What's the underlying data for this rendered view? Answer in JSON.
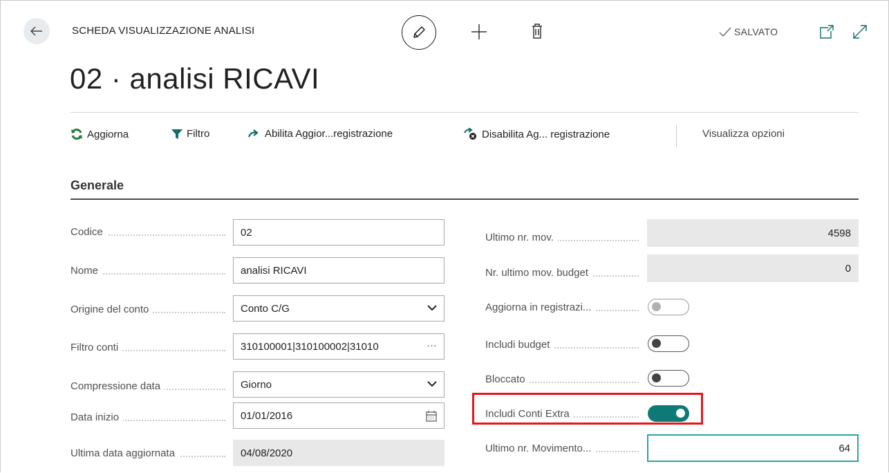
{
  "header": {
    "caption": "SCHEDA VISUALIZZAZIONE ANALISI",
    "title": "02 · analisi RICAVI",
    "saved_status": "SALVATO"
  },
  "actions": [
    {
      "label": "Aggiorna",
      "icon": "refresh-icon"
    },
    {
      "label": "Filtro",
      "icon": "filter-icon"
    },
    {
      "label": "Abilita Aggior...registrazione",
      "icon": "enable-update-icon"
    },
    {
      "label": "Disabilita Ag... registrazione",
      "icon": "disable-update-icon"
    },
    {
      "label": "Visualizza opzioni"
    }
  ],
  "section": {
    "title": "Generale"
  },
  "left_fields": {
    "code": {
      "label": "Codice",
      "value": "02"
    },
    "name": {
      "label": "Nome",
      "value": "analisi RICAVI"
    },
    "account_source": {
      "label": "Origine del conto",
      "value": "Conto C/G"
    },
    "account_filter": {
      "label": "Filtro conti",
      "value": "310100001|310100002|31010",
      "suffix": "···"
    },
    "date_compression": {
      "label": "Compressione data",
      "value": "Giorno"
    },
    "start_date": {
      "label": "Data inizio",
      "value": "01/01/2016"
    },
    "last_updated_date": {
      "label": "Ultima data aggiornata",
      "value": "04/08/2020"
    }
  },
  "right_fields": {
    "last_entry_no": {
      "label": "Ultimo nr. mov.",
      "value": "4598"
    },
    "last_budget_entry_no": {
      "label": "Nr. ultimo mov. budget",
      "value": "0"
    },
    "update_on_posting": {
      "label": "Aggiorna in registrazi...",
      "state": "off-disabled"
    },
    "include_budgets": {
      "label": "Includi budget",
      "state": "off"
    },
    "blocked": {
      "label": "Bloccato",
      "state": "off"
    },
    "include_extra_accounts": {
      "label": "Includi Conti Extra",
      "state": "on"
    },
    "last_entry_no_movement": {
      "label": "Ultimo nr. Movimento...",
      "value": "64"
    }
  },
  "colors": {
    "toggle_on": "#0e7a78",
    "highlight": "#e8141a",
    "focus_border": "#2aa5a5"
  }
}
